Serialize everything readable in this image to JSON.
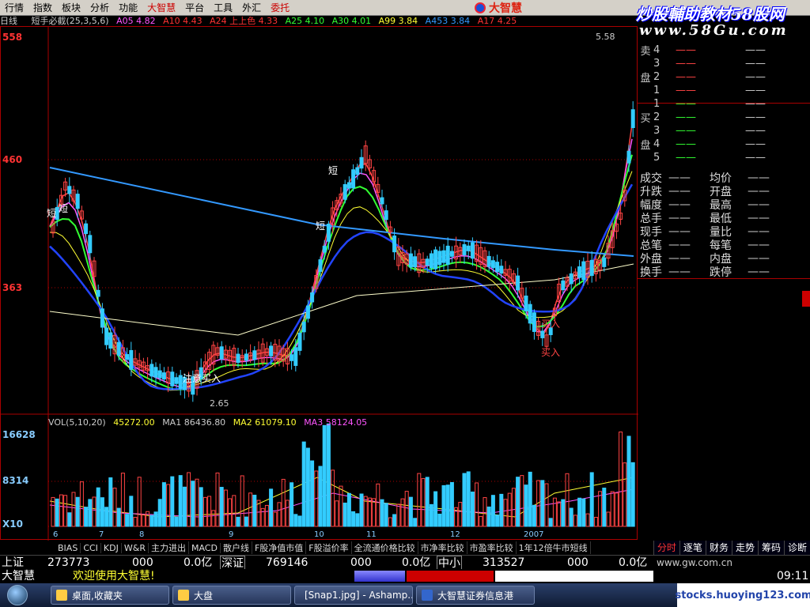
{
  "menu": [
    "行情",
    "指数",
    "板块",
    "分析",
    "功能",
    "大智慧",
    "平台",
    "工具",
    "外汇",
    "委托"
  ],
  "brand": {
    "name": "大智慧"
  },
  "watermark": {
    "line1": "炒股輔助教材58股网",
    "line2": "www.58Gu.com"
  },
  "period_label": "日线",
  "indicators": [
    {
      "text": "短手必截(25,3,5,6)",
      "color": "#ccc"
    },
    {
      "text": "A05 4.82",
      "color": "#f5f"
    },
    {
      "text": "A10 4.43",
      "color": "#f33"
    },
    {
      "text": "A24 上上色 4.33",
      "color": "#f33"
    },
    {
      "text": "A25 4.10",
      "color": "#3f3"
    },
    {
      "text": "A30 4.01",
      "color": "#3f3"
    },
    {
      "text": "A99 3.84",
      "color": "#ff3"
    },
    {
      "text": "A453 3.84",
      "color": "#39f"
    },
    {
      "text": "A17 4.25",
      "color": "#f33"
    }
  ],
  "price_axis": [
    {
      "label": "558",
      "color": "#f33"
    },
    {
      "label": "460",
      "color": "#f33"
    },
    {
      "label": "363",
      "color": "#f33"
    }
  ],
  "vol_axis": [
    {
      "label": "16628",
      "color": "#8cf"
    },
    {
      "label": "8314",
      "color": "#8cf"
    },
    {
      "label": "X10",
      "color": "#8cf"
    }
  ],
  "vol_legend": [
    {
      "text": "VOL(5,10,20)",
      "color": "#ccc"
    },
    {
      "text": "45272.00",
      "color": "#ff3"
    },
    {
      "text": "MA1 86436.80",
      "color": "#ccc"
    },
    {
      "text": "MA2 61079.10",
      "color": "#ff3"
    },
    {
      "text": "MA3 58124.05",
      "color": "#f5f"
    }
  ],
  "chart_annotations": {
    "high": "5.58",
    "low": "2.65",
    "buy_notice": "注意买入",
    "short_tags": [
      "短",
      "短",
      "短",
      "短"
    ],
    "buy_tags": [
      "买入",
      "买入"
    ]
  },
  "x_ticks": [
    "6",
    "7",
    "8",
    "9",
    "10",
    "11",
    "12",
    "2007"
  ],
  "orderbook": {
    "sell_label": [
      "卖",
      "盘"
    ],
    "buy_label": [
      "买",
      "盘"
    ],
    "sell": [
      {
        "n": "4",
        "p": "——",
        "v": "——"
      },
      {
        "n": "3",
        "p": "——",
        "v": "——"
      },
      {
        "n": "2",
        "p": "——",
        "v": "——"
      },
      {
        "n": "1",
        "p": "——",
        "v": "——"
      }
    ],
    "buy": [
      {
        "n": "1",
        "p": "——",
        "v": "——"
      },
      {
        "n": "2",
        "p": "——",
        "v": "——"
      },
      {
        "n": "3",
        "p": "——",
        "v": "——"
      },
      {
        "n": "4",
        "p": "——",
        "v": "——"
      },
      {
        "n": "5",
        "p": "——",
        "v": "——"
      }
    ]
  },
  "quote": [
    {
      "l": "成交",
      "d1": "——",
      "m": "均价",
      "d2": "——"
    },
    {
      "l": "升跌",
      "d1": "——",
      "m": "开盘",
      "d2": "——"
    },
    {
      "l": "幅度",
      "d1": "——",
      "m": "最高",
      "d2": "——"
    },
    {
      "l": "总手",
      "d1": "——",
      "m": "最低",
      "d2": "——"
    },
    {
      "l": "现手",
      "d1": "——",
      "m": "量比",
      "d2": "——"
    },
    {
      "l": "总笔",
      "d1": "——",
      "m": "每笔",
      "d2": "——"
    },
    {
      "l": "外盘",
      "d1": "——",
      "m": "内盘",
      "d2": "——"
    },
    {
      "l": "换手",
      "d1": "——",
      "m": "跌停",
      "d2": "——"
    }
  ],
  "tabs": [
    "BIAS",
    "CCI",
    "KDJ",
    "W&R",
    "主力进出",
    "MACD",
    "散户线",
    "F股净值市值",
    "F股溢价率",
    "全流通价格比较",
    "市净率比较",
    "市盈率比较",
    "1年12倍牛市短线"
  ],
  "right_tabs": [
    {
      "t": "分时",
      "active": true
    },
    {
      "t": "逐笔",
      "active": false
    },
    {
      "t": "财务",
      "active": false
    },
    {
      "t": "走势",
      "active": false
    },
    {
      "t": "筹码",
      "active": false
    },
    {
      "t": "诊断",
      "active": false
    }
  ],
  "index_bar": {
    "sh_label": "上证",
    "sh_val": "273773",
    "sh_v2": "000",
    "sh_v3": "0.0亿",
    "sz_label": "深证",
    "sz_val": "769146",
    "sz_v2": "000",
    "sz_v3": "0.0亿",
    "zx_label": "中小",
    "zx_val": "313527",
    "zx_v2": "000",
    "zx_v3": "0.0亿",
    "url": "www.gw.com.cn"
  },
  "status": {
    "app": "大智慧",
    "welcome": "欢迎使用大智慧!",
    "time": "09:11"
  },
  "taskbar": {
    "items": [
      "桌面,收藏夹",
      "大盘",
      "[Snap1.jpg] - Ashamp...",
      "大智慧证券信息港"
    ],
    "watermark": "stocks.huoying123.com"
  }
}
